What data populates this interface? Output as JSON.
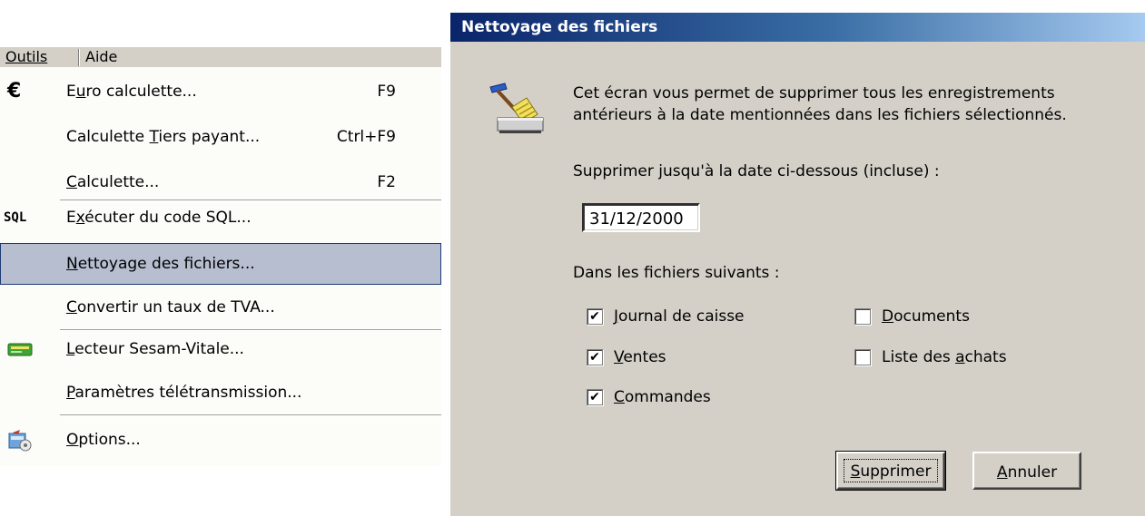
{
  "menubar": {
    "outils_label": "Outils",
    "aide_label": "Aide"
  },
  "menu": {
    "items": [
      {
        "pre": "E",
        "acc": "u",
        "post": "ro calculette...",
        "shortcut": "F9",
        "icon": "euro-icon"
      },
      {
        "pre": "Calculette ",
        "acc": "T",
        "post": "iers payant...",
        "shortcut": "Ctrl+F9",
        "icon": ""
      },
      {
        "pre": "",
        "acc": "C",
        "post": "alculette...",
        "shortcut": "F2",
        "icon": ""
      },
      {
        "pre": "E",
        "acc": "x",
        "post": "écuter du code SQL...",
        "shortcut": "",
        "icon": "sql-icon"
      },
      {
        "pre": "",
        "acc": "N",
        "post": "ettoyage des fichiers...",
        "shortcut": "",
        "icon": ""
      },
      {
        "pre": "",
        "acc": "C",
        "post": "onvertir un taux de TVA...",
        "shortcut": "",
        "icon": ""
      },
      {
        "pre": "",
        "acc": "L",
        "post": "ecteur Sesam-Vitale...",
        "shortcut": "",
        "icon": "card-reader-icon"
      },
      {
        "pre": "",
        "acc": "P",
        "post": "aramètres télétransmission...",
        "shortcut": "",
        "icon": ""
      },
      {
        "pre": "",
        "acc": "O",
        "post": "ptions...",
        "shortcut": "",
        "icon": "options-icon"
      }
    ],
    "sql_icon_text": "SQL",
    "euro_icon_text": "€"
  },
  "dialog": {
    "title": "Nettoyage des fichiers",
    "description_line1": "Cet écran vous permet de supprimer tous les enregistrements",
    "description_line2": "antérieurs à la date mentionnées dans les fichiers sélectionnés.",
    "date_label": "Supprimer jusqu'à la date ci-dessous (incluse) :",
    "date_value": "31/12/2000",
    "files_label": "Dans les fichiers suivants :",
    "checkboxes": [
      {
        "pre": "",
        "acc": "J",
        "post": "ournal de caisse",
        "checked": true
      },
      {
        "pre": "",
        "acc": "V",
        "post": "entes",
        "checked": true
      },
      {
        "pre": "",
        "acc": "C",
        "post": "ommandes",
        "checked": true
      },
      {
        "pre": "",
        "acc": "D",
        "post": "ocuments",
        "checked": false
      },
      {
        "pre": "Liste des ",
        "acc": "a",
        "post": "chats",
        "checked": false
      }
    ],
    "btn_supprimer": {
      "pre": "",
      "acc": "S",
      "post": "upprimer"
    },
    "btn_annuler": {
      "pre": "",
      "acc": "A",
      "post": "nnuler"
    },
    "check_mark": "✔"
  },
  "colors": {
    "title_start": "#0a246a",
    "title_end": "#a6caf0",
    "menu_highlight": "#b6bed0",
    "dialog_bg": "#d4d0c8"
  }
}
